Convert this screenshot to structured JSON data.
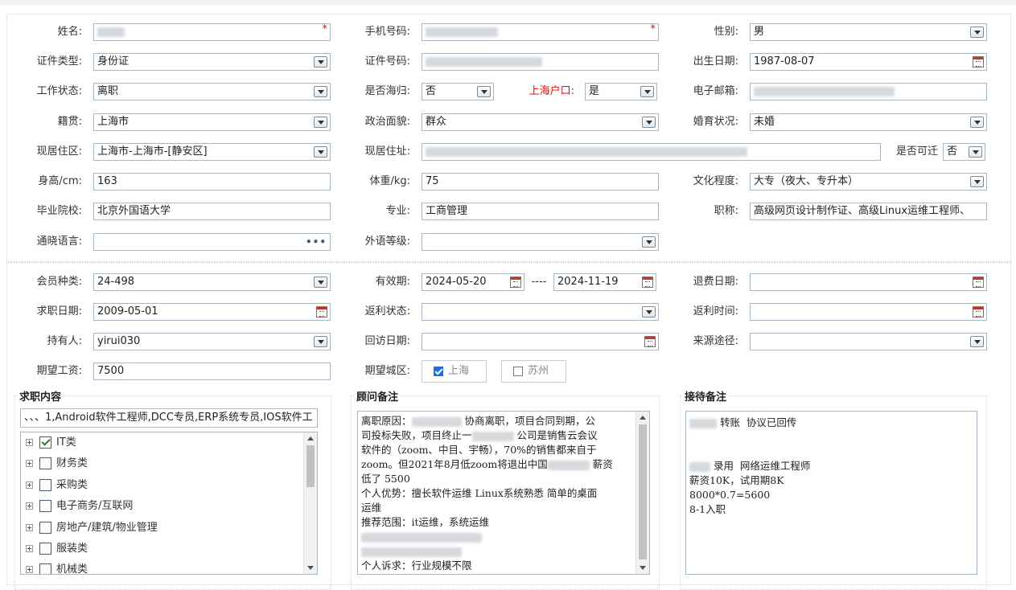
{
  "basic": {
    "name_label": "姓名:",
    "phone_label": "手机号码:",
    "gender_label": "性别:",
    "gender_value": "男",
    "idtype_label": "证件类型:",
    "idtype_value": "身份证",
    "idnum_label": "证件号码:",
    "birth_label": "出生日期:",
    "birth_value": "1987-08-07",
    "work_label": "工作状态:",
    "work_value": "离职",
    "overseas_label": "是否海归:",
    "overseas_value": "否",
    "shhukou_label": "上海户口:",
    "shhukou_value": "是",
    "email_label": "电子邮箱:",
    "native_label": "籍贯:",
    "native_value": "上海市",
    "political_label": "政治面貌:",
    "political_value": "群众",
    "marital_label": "婚育状况:",
    "marital_value": "未婚",
    "area_label": "现居住区:",
    "area_value": "上海市-上海市-[静安区]",
    "address_label": "现居住址:",
    "relocate_label": "是否可迁",
    "relocate_value": "否",
    "height_label": "身高/cm:",
    "height_value": "163",
    "weight_label": "体重/kg:",
    "weight_value": "75",
    "edu_label": "文化程度:",
    "edu_value": "大专（夜大、专升本）",
    "school_label": "毕业院校:",
    "school_value": "北京外国语大学",
    "major_label": "专业:",
    "major_value": "工商管理",
    "title_label": "职称:",
    "title_value": "高级网页设计制作证、高级Linux运维工程师、",
    "lang_label": "通晓语言:",
    "lang_more": "•••",
    "fl_label": "外语等级:"
  },
  "member": {
    "type_label": "会员种类:",
    "type_value": "24-498",
    "valid_label": "有效期:",
    "valid_from": "2024-05-20",
    "valid_sep": "----",
    "valid_to": "2024-11-19",
    "refund_label": "退费日期:",
    "jobdate_label": "求职日期:",
    "jobdate_value": "2009-05-01",
    "rebate_label": "返利状态:",
    "rebatetime_label": "返利时间:",
    "holder_label": "持有人:",
    "holder_value": "yirui030",
    "visit_label": "回访日期:",
    "source_label": "来源途径:",
    "salary_label": "期望工资:",
    "salary_value": "7500",
    "city_label": "期望城区:",
    "city_sh": "上海",
    "city_sz": "苏州"
  },
  "job": {
    "section_title": "求职内容",
    "summary": "、、、1,Android软件工程师,DCC专员,ERP系统专员,IOS软件工",
    "tree": [
      {
        "label": "IT类",
        "checked": true
      },
      {
        "label": "财务类",
        "checked": false
      },
      {
        "label": "采购类",
        "checked": false
      },
      {
        "label": "电子商务/互联网",
        "checked": false
      },
      {
        "label": "房地产/建筑/物业管理",
        "checked": false
      },
      {
        "label": "服装类",
        "checked": false
      },
      {
        "label": "机械类",
        "checked": false
      }
    ]
  },
  "consultant": {
    "section_title": "顾问备注",
    "l1a": "离职原因：",
    "l1b": " 协商离职，项目合同到期，公",
    "l2": "司投标失败，项目终止一",
    "l2b": " 公司是销售云会议",
    "l3": "软件的（zoom、中目、宇畅），70%的销售都来自于",
    "l4a": "zoom。但2021年8月低zoom将退出中国",
    "l4b": " 薪资",
    "l5": "低了 5500",
    "l6": "个人优势：擅长软件运维 Linux系统熟悉 简单的桌面",
    "l7": "运维",
    "l8": "推荐范围：it运维，系统运维",
    "l11": "个人诉求：行业规模不限"
  },
  "reception": {
    "section_title": "接待备注",
    "l1": " 转账  协议已回传",
    "l2": " 录用  网络运维工程师",
    "l3": "薪资10K，试用期8K",
    "l4": "8000*0.7=5600",
    "l5": "8-1入职"
  }
}
